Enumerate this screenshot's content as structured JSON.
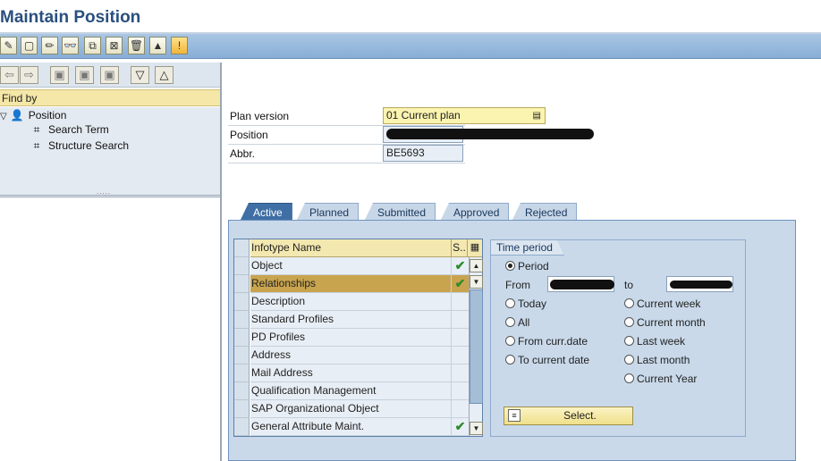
{
  "window": {
    "title": "Maintain Position"
  },
  "toolbar": {
    "buttons": [
      {
        "name": "change-icon",
        "glyph": "✎"
      },
      {
        "name": "create-icon",
        "glyph": "▢"
      },
      {
        "name": "edit-pencil-icon",
        "glyph": "✏"
      },
      {
        "name": "display-icon",
        "glyph": "👓"
      },
      {
        "name": "copy-icon",
        "glyph": "⧉"
      },
      {
        "name": "delimit-icon",
        "glyph": "⊠"
      },
      {
        "name": "delete-icon",
        "glyph": "🗑"
      },
      {
        "name": "overview-icon",
        "glyph": "▲"
      },
      {
        "name": "info-icon",
        "glyph": "!"
      }
    ]
  },
  "left_panel": {
    "buttons": [
      {
        "name": "back-arrow-icon",
        "glyph": "⇦"
      },
      {
        "name": "forward-arrow-icon",
        "glyph": "⇨"
      },
      {
        "name": "tree-tool-1-icon",
        "glyph": "▣"
      },
      {
        "name": "tree-tool-2-icon",
        "glyph": "▣"
      },
      {
        "name": "tree-tool-3-icon",
        "glyph": "▣"
      },
      {
        "name": "expand-all-icon",
        "glyph": "▽"
      },
      {
        "name": "collapse-all-icon",
        "glyph": "△"
      }
    ],
    "find_by_label": "Find by",
    "tree": {
      "root": "Position",
      "children": [
        "Search Term",
        "Structure Search"
      ]
    }
  },
  "header_fields": {
    "plan_version_label": "Plan version",
    "plan_version_value": "01 Current plan",
    "position_label": "Position",
    "abbr_label": "Abbr.",
    "abbr_value": "BE5693"
  },
  "tabs": [
    "Active",
    "Planned",
    "Submitted",
    "Approved",
    "Rejected"
  ],
  "infotype_table": {
    "col_name": "Infotype Name",
    "col_status": "S..",
    "rows": [
      {
        "name": "Object",
        "status": "✔"
      },
      {
        "name": "Relationships",
        "status": "✔"
      },
      {
        "name": "Description",
        "status": ""
      },
      {
        "name": "Standard Profiles",
        "status": ""
      },
      {
        "name": "PD Profiles",
        "status": ""
      },
      {
        "name": "Address",
        "status": ""
      },
      {
        "name": "Mail Address",
        "status": ""
      },
      {
        "name": "Qualification Management",
        "status": ""
      },
      {
        "name": "SAP Organizational Object",
        "status": ""
      },
      {
        "name": "General Attribute Maint.",
        "status": "✔"
      }
    ]
  },
  "time_period": {
    "title": "Time period",
    "period": "Period",
    "from_label": "From",
    "to_label": "to",
    "left_options": [
      "Today",
      "All",
      "From curr.date",
      "To current date"
    ],
    "right_options": [
      "Current week",
      "Current month",
      "Last week",
      "Last month",
      "Current Year"
    ],
    "select_button": "Select."
  },
  "colors": {
    "accent": "#3f6fa5",
    "toolbar": "#a9c6e4",
    "highlight_row": "#c8a44e",
    "check_green": "#2e8b2e"
  }
}
